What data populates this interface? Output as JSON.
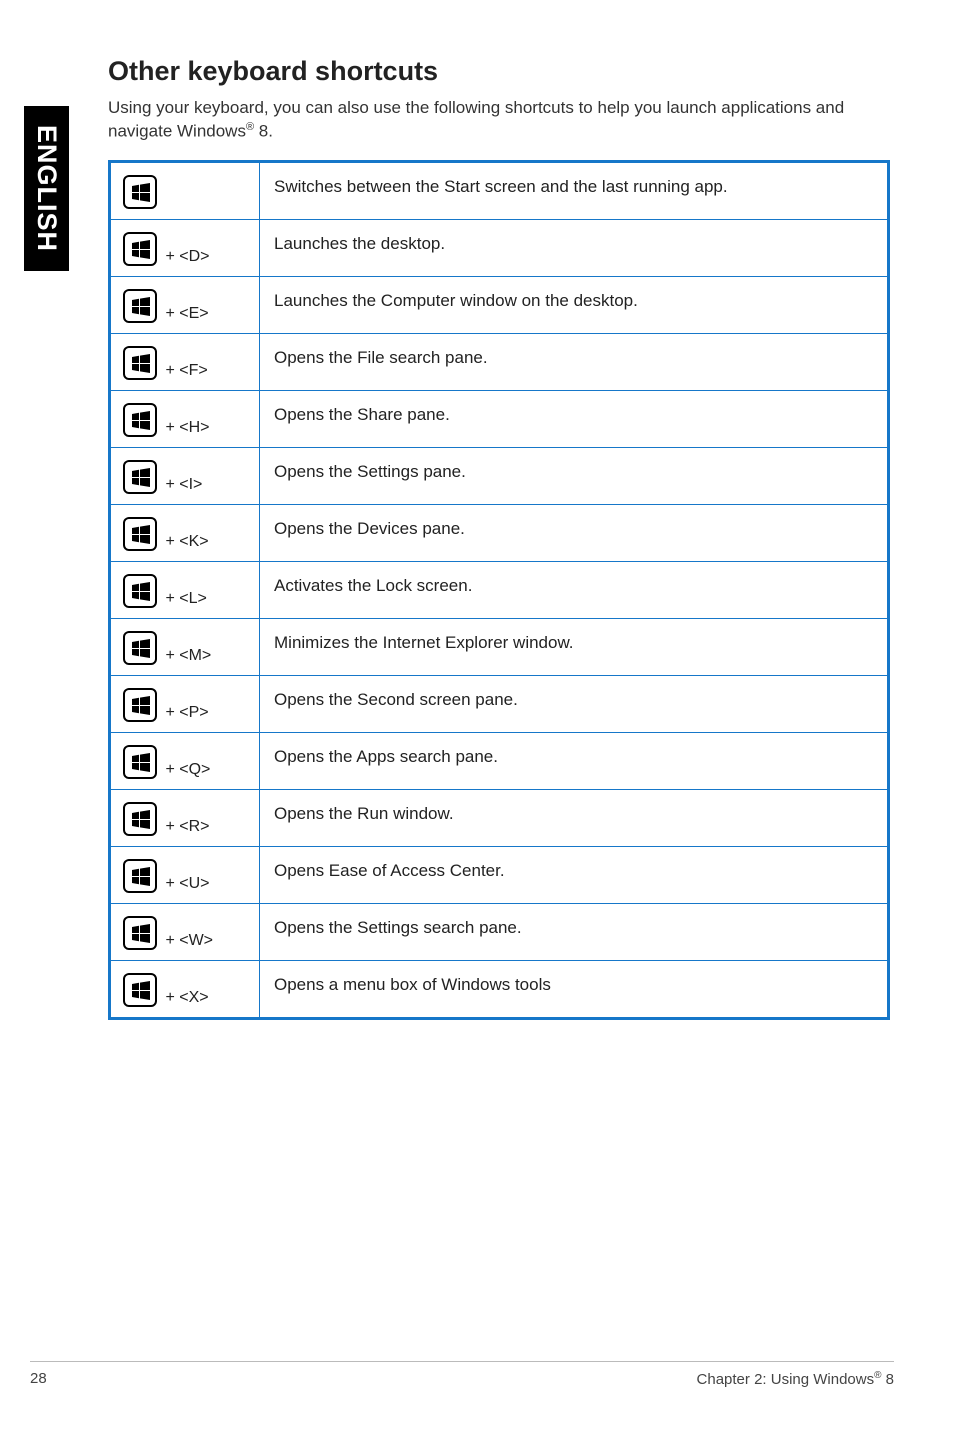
{
  "side_tab": "ENGLISH",
  "heading": "Other keyboard shortcuts",
  "intro_before_reg": "Using your keyboard, you can also use the following shortcuts to help you launch applications and navigate Windows",
  "intro_reg": "®",
  "intro_after_reg": " 8.",
  "rows": [
    {
      "combo": "",
      "desc": "Switches between the Start screen and the last running app."
    },
    {
      "combo": " + <D>",
      "desc": "Launches the desktop."
    },
    {
      "combo": " + <E>",
      "desc": "Launches the Computer window on the desktop."
    },
    {
      "combo": " + <F>",
      "desc": "Opens the File search pane."
    },
    {
      "combo": " + <H>",
      "desc": "Opens the Share pane."
    },
    {
      "combo": " + <I>",
      "desc": "Opens the Settings pane."
    },
    {
      "combo": " + <K>",
      "desc": "Opens the Devices pane."
    },
    {
      "combo": " + <L>",
      "desc": "Activates the Lock screen."
    },
    {
      "combo": " + <M>",
      "desc": "Minimizes the Internet Explorer window."
    },
    {
      "combo": " + <P>",
      "desc": "Opens the Second screen pane."
    },
    {
      "combo": " + <Q>",
      "desc": "Opens the Apps search pane."
    },
    {
      "combo": " + <R>",
      "desc": "Opens the Run window."
    },
    {
      "combo": " + <U>",
      "desc": "Opens Ease of Access Center."
    },
    {
      "combo": " + <W>",
      "desc": "Opens the Settings search pane."
    },
    {
      "combo": " + <X>",
      "desc": "Opens a menu box of Windows tools"
    }
  ],
  "footer": {
    "page_number": "28",
    "chapter_before_reg": "Chapter 2: Using Windows",
    "chapter_reg": "®",
    "chapter_after_reg": " 8"
  }
}
